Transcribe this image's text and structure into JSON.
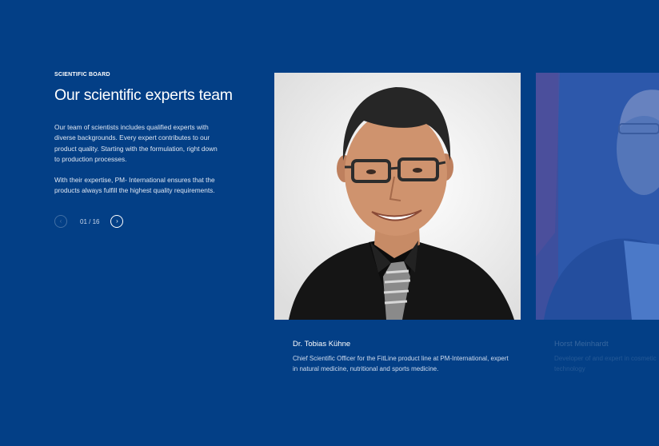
{
  "section": {
    "eyebrow": "SCIENTIFIC BOARD",
    "title": "Our scientific experts team",
    "description_1": "Our team of scientists includes qualified experts with diverse backgrounds. Every expert contributes to our product quality. Starting with the formulation, right down to production processes.",
    "description_2": "With their expertise, PM- International ensures that the products always fulfill the highest quality requirements."
  },
  "pager": {
    "counter": "01 / 16",
    "prev_icon": "chevron-left-icon",
    "next_icon": "chevron-right-icon"
  },
  "experts": [
    {
      "name": "Dr. Tobias Kühne",
      "role": "Chief Scientific Officer for the FitLine product line at PM-International, expert in natural medicine, nutritional and sports medicine."
    },
    {
      "name": "Horst Meinhardt",
      "role": "Developer of and expert in cosmetic technology"
    }
  ],
  "colors": {
    "background": "#033f86",
    "text": "#ffffff"
  }
}
